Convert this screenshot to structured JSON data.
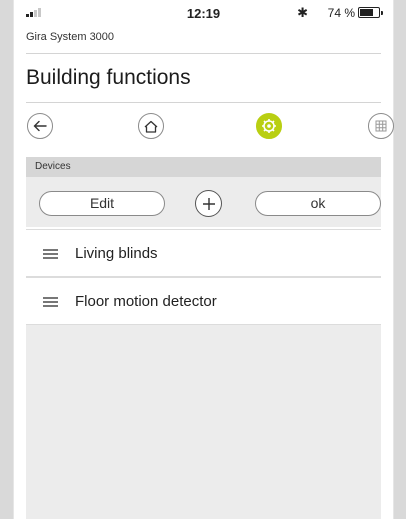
{
  "status_bar": {
    "time": "12:19",
    "bluetooth_icon": "bluetooth-icon",
    "battery_percent": "74 %",
    "battery_level": 0.74,
    "signal_bars_filled": 2
  },
  "app": {
    "system_name": "Gira System 3000",
    "title": "Building functions"
  },
  "nav": {
    "back_icon": "back-arrow-icon",
    "home_icon": "home-icon",
    "settings_icon": "gear-icon",
    "grid_icon": "grid-icon",
    "active": "settings",
    "accent_color": "#b9cf12"
  },
  "devices": {
    "section_label": "Devices",
    "edit_label": "Edit",
    "add_icon": "plus-icon",
    "ok_label": "ok",
    "items": [
      {
        "label": "Living blinds"
      },
      {
        "label": "Floor motion detector"
      }
    ]
  }
}
